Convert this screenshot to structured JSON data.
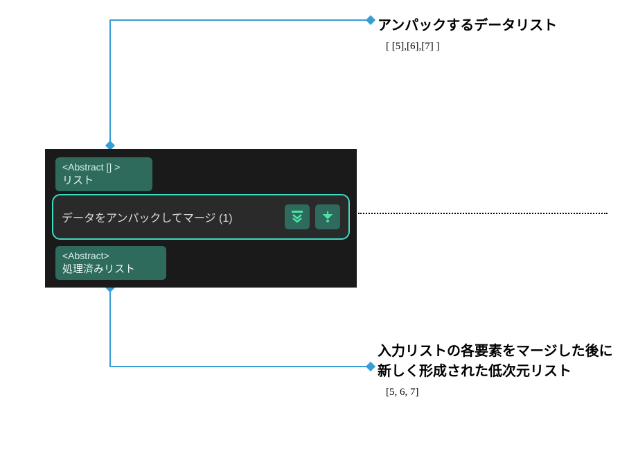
{
  "annotation_top": {
    "title": "アンパックするデータリスト",
    "code": "[ [5],[6],[7] ]"
  },
  "annotation_bottom": {
    "title": "入力リストの各要素をマージした後に新しく形成された低次元リスト",
    "code": "[5, 6, 7]"
  },
  "node": {
    "input_port": {
      "type": "<Abstract [] >",
      "label": "リスト"
    },
    "main_label": "データをアンパックしてマージ (1)",
    "output_port": {
      "type": "<Abstract>",
      "label": "処理済みリスト"
    }
  }
}
